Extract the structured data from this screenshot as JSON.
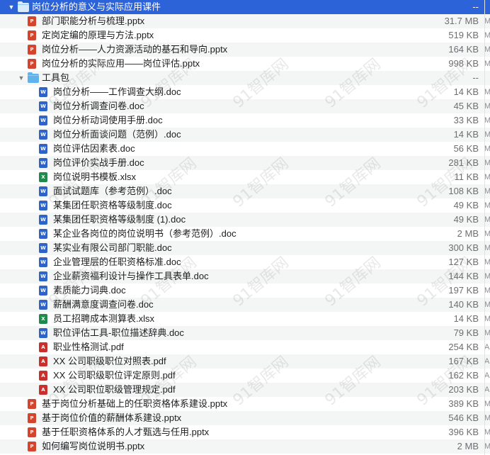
{
  "watermark_text": "91智库网",
  "rows": [
    {
      "level": 0,
      "type": "folder",
      "expanded": true,
      "name": "岗位分析的意义与实际应用课件",
      "size": "--",
      "edge": "",
      "selected": true
    },
    {
      "level": 1,
      "type": "pptx",
      "name": "部门职能分析与梳理.pptx",
      "size": "31.7 MB",
      "edge": "M"
    },
    {
      "level": 1,
      "type": "pptx",
      "name": "定岗定编的原理与方法.pptx",
      "size": "519 KB",
      "edge": "M"
    },
    {
      "level": 1,
      "type": "pptx",
      "name": "岗位分析——人力资源活动的基石和导向.pptx",
      "size": "164 KB",
      "edge": "M"
    },
    {
      "level": 1,
      "type": "pptx",
      "name": "岗位分析的实际应用——岗位评估.pptx",
      "size": "998 KB",
      "edge": "M"
    },
    {
      "level": 1,
      "type": "folder",
      "expanded": true,
      "name": "工具包",
      "size": "--",
      "edge": ""
    },
    {
      "level": 2,
      "type": "doc",
      "name": "岗位分析——工作调查大纲.doc",
      "size": "14 KB",
      "edge": "M"
    },
    {
      "level": 2,
      "type": "doc",
      "name": "岗位分析调查问卷.doc",
      "size": "45 KB",
      "edge": "M"
    },
    {
      "level": 2,
      "type": "doc",
      "name": "岗位分析动词使用手册.doc",
      "size": "33 KB",
      "edge": "M"
    },
    {
      "level": 2,
      "type": "doc",
      "name": "岗位分析面谈问题（范例）.doc",
      "size": "14 KB",
      "edge": "M"
    },
    {
      "level": 2,
      "type": "doc",
      "name": "岗位评估因素表.doc",
      "size": "56 KB",
      "edge": "M"
    },
    {
      "level": 2,
      "type": "doc",
      "name": "岗位评价实战手册.doc",
      "size": "281 KB",
      "edge": "M"
    },
    {
      "level": 2,
      "type": "xlsx",
      "name": "岗位说明书模板.xlsx",
      "size": "11 KB",
      "edge": "M"
    },
    {
      "level": 2,
      "type": "doc",
      "name": "面试试题库（参考范例）.doc",
      "size": "108 KB",
      "edge": "M"
    },
    {
      "level": 2,
      "type": "doc",
      "name": "某集团任职资格等级制度.doc",
      "size": "49 KB",
      "edge": "M"
    },
    {
      "level": 2,
      "type": "doc",
      "name": "某集团任职资格等级制度 (1).doc",
      "size": "49 KB",
      "edge": "M"
    },
    {
      "level": 2,
      "type": "doc",
      "name": "某企业各岗位的岗位说明书（参考范例）.doc",
      "size": "2 MB",
      "edge": "M"
    },
    {
      "level": 2,
      "type": "doc",
      "name": "某实业有限公司部门职能.doc",
      "size": "300 KB",
      "edge": "M"
    },
    {
      "level": 2,
      "type": "doc",
      "name": "企业管理层的任职资格标准.doc",
      "size": "127 KB",
      "edge": "M"
    },
    {
      "level": 2,
      "type": "doc",
      "name": "企业薪资福利设计与操作工具表单.doc",
      "size": "144 KB",
      "edge": "M"
    },
    {
      "level": 2,
      "type": "doc",
      "name": "素质能力词典.doc",
      "size": "197 KB",
      "edge": "M"
    },
    {
      "level": 2,
      "type": "doc",
      "name": "薪酬满意度调查问卷.doc",
      "size": "140 KB",
      "edge": "M"
    },
    {
      "level": 2,
      "type": "xlsx",
      "name": "员工招聘成本测算表.xlsx",
      "size": "14 KB",
      "edge": "M"
    },
    {
      "level": 2,
      "type": "doc",
      "name": "职位评估工具-职位描述辞典.doc",
      "size": "79 KB",
      "edge": "M"
    },
    {
      "level": 2,
      "type": "pdf",
      "name": "职业性格测试.pdf",
      "size": "254 KB",
      "edge": "A"
    },
    {
      "level": 2,
      "type": "pdf",
      "name": "XX 公司职级职位对照表.pdf",
      "size": "167 KB",
      "edge": "A"
    },
    {
      "level": 2,
      "type": "pdf",
      "name": "XX 公司职级职位评定原则.pdf",
      "size": "162 KB",
      "edge": "A"
    },
    {
      "level": 2,
      "type": "pdf",
      "name": "XX 公司职位职级管理规定.pdf",
      "size": "203 KB",
      "edge": "A"
    },
    {
      "level": 1,
      "type": "pptx",
      "name": "基于岗位分析基础上的任职资格体系建设.pptx",
      "size": "389 KB",
      "edge": "M"
    },
    {
      "level": 1,
      "type": "pptx",
      "name": "基于岗位价值的薪酬体系建设.pptx",
      "size": "546 KB",
      "edge": "M"
    },
    {
      "level": 1,
      "type": "pptx",
      "name": "基于任职资格体系的人才甄选与任用.pptx",
      "size": "396 KB",
      "edge": "M"
    },
    {
      "level": 1,
      "type": "pptx",
      "name": "如何编写岗位说明书.pptx",
      "size": "2 MB",
      "edge": "M"
    }
  ]
}
